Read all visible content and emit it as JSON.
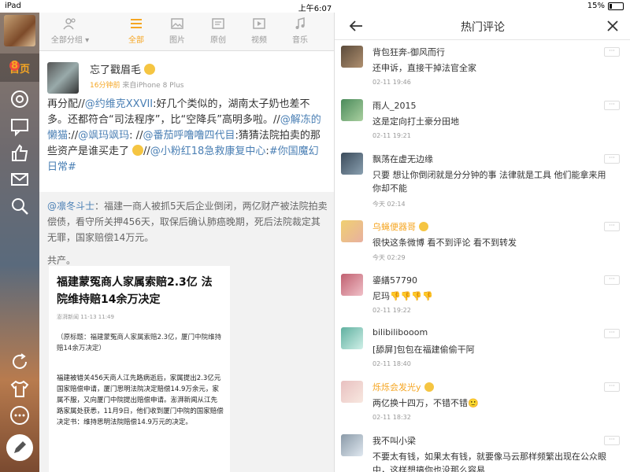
{
  "statusbar": {
    "left": "iPad",
    "time": "上午6:07",
    "battery": "15%"
  },
  "rail": {
    "home_label": "首页",
    "home_badge": "8"
  },
  "toolbar": {
    "tabs": [
      {
        "label": "全部分组 ▾"
      },
      {
        "label": "全部"
      },
      {
        "label": "图片"
      },
      {
        "label": "原创"
      },
      {
        "label": "视频"
      },
      {
        "label": "音乐"
      }
    ]
  },
  "post": {
    "username": "忘了戳眉毛",
    "time": "16分钟前",
    "source": "来自iPhone 8 Plus",
    "text_parts": [
      "再分配//",
      "@约维克XXVII",
      ":好几个类似的，湖南太子奶也差不多。还都符合“司法程序”，比“空降兵”高明多啦。//",
      "@解冻的懒猫",
      "://",
      "@飒玛飒玛",
      ": //",
      "@番茄呼噜噜四代目",
      ":猜猜法院拍卖的那些资产是谁买走了",
      "//",
      "@小粉红18急救康复中心",
      ":",
      "#你国魔幻日常#"
    ]
  },
  "repost": {
    "author": "@凛冬斗士",
    "text": "：福建一商人被抓5天后企业倒闭，两亿财产被法院拍卖偿债，看守所关押456天，取保后确认肺癌晚期，死后法院裁定其无罪，国家赔偿14万元。",
    "share": "共产。",
    "article": {
      "headline": "福建蒙冤商人家属索赔2.3亿 法院维持赔14余万决定",
      "source": "澎湃新闻   11-13 11:49",
      "p1": "（原标题：福建蒙冤商人家属索赔2.3亿，厦门中院维持赔14余万决定）",
      "p2": "福建被错关456天商人江先路病逝后，家属提出2.3亿元国家赔偿申请，厦门思明法院决定赔偿14.9万余元，家属不服，又向厦门中院提出赔偿申请。澎湃新闻从江先路家属处获悉，11月9日，他们收到厦门中院的国家赔偿决定书：维持思明法院赔偿14.9万元的决定。"
    }
  },
  "panel": {
    "title": "热门评论",
    "comments": [
      {
        "name": "背包狂奔-御风而行",
        "text": "还申诉，直接干掉法官全家",
        "time": "02-11 19:46",
        "vip": false,
        "emoji": false
      },
      {
        "name": "雨人_2015",
        "text": "这是定向打土豪分田地",
        "time": "02-11 19:21",
        "vip": false,
        "emoji": false
      },
      {
        "name": "飘荡在虚无边缘",
        "text": "只要 想让你倒闭就是分分钟的事 法律就是工具 他们能拿来用 你却不能",
        "time": "今天 02:14",
        "vip": false,
        "emoji": false
      },
      {
        "name": "乌蝇便器哥",
        "text": "很快这条微博 看不到评论 看不到转发",
        "time": "今天 02:29",
        "vip": true,
        "emoji": true
      },
      {
        "name": "鎏繕57790",
        "text": "尼玛👎👎👎👎",
        "time": "02-11 19:22",
        "vip": false,
        "emoji": false
      },
      {
        "name": "bilibilibooom",
        "text": "[舔屏]包包在福建偷偷干阿",
        "time": "02-11 18:40",
        "vip": false,
        "emoji": false
      },
      {
        "name": "烁烁会发光y",
        "text": "两亿换十四万，不错不错🙂",
        "time": "02-11 18:32",
        "vip": true,
        "emoji": true
      },
      {
        "name": "我不叫小梁",
        "text": "不要太有钱，如果太有钱，就要像马云那样频繁出现在公众眼中，这样想搞你也没那么容易",
        "time": "",
        "vip": false,
        "emoji": false
      }
    ]
  },
  "colors": {
    "accent": "#f5a623",
    "link": "#4a7fb4",
    "badge": "#f04b3c"
  }
}
